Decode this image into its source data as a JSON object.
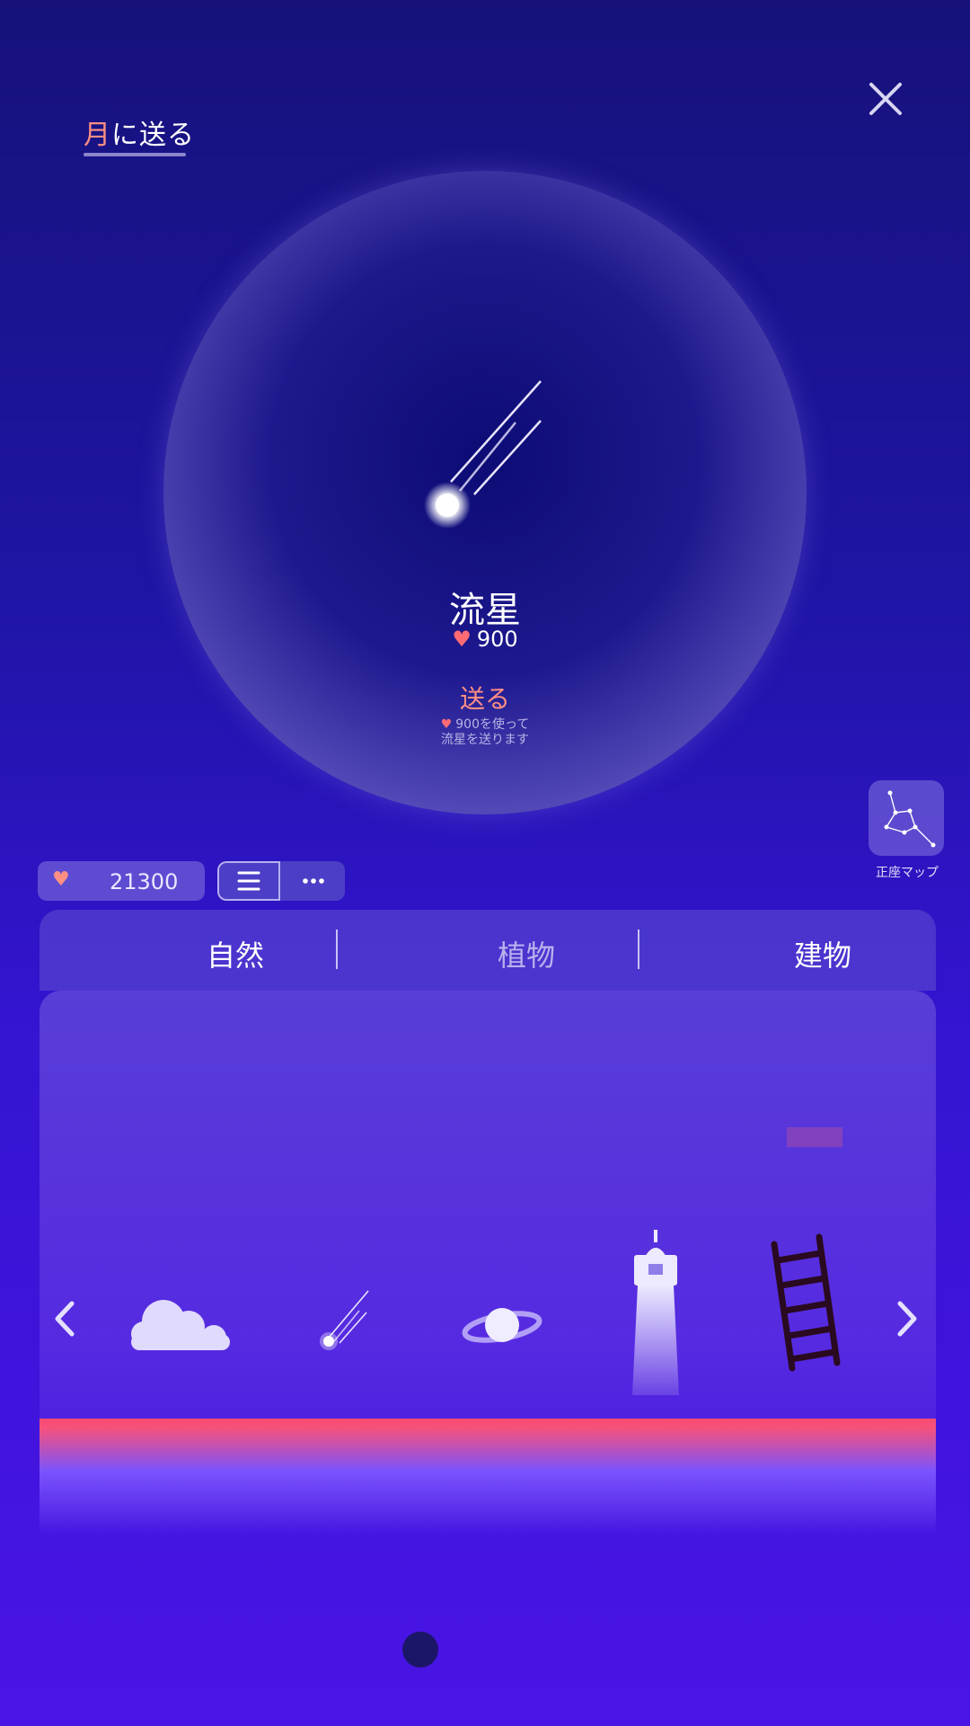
{
  "header": {
    "title_highlight": "月",
    "title_rest": "に送る",
    "close_icon": "close-icon"
  },
  "selected_item": {
    "name": "流星",
    "price": "900",
    "send_label": "送る",
    "send_note_line1": "900を使って",
    "send_note_line2": "流星を送ります",
    "icon": "meteor-icon"
  },
  "constellation": {
    "label": "正座マップ",
    "icon": "constellation-icon"
  },
  "wallet": {
    "hearts": "21300",
    "icon": "heart-icon"
  },
  "view_toggle": {
    "list_icon": "list-icon",
    "more_icon": "more-icon"
  },
  "tabs": [
    {
      "label": "自然"
    },
    {
      "label": "植物"
    },
    {
      "label": "建物"
    }
  ],
  "items": [
    {
      "icon": "cloud-icon"
    },
    {
      "icon": "meteor-icon"
    },
    {
      "icon": "planet-icon"
    },
    {
      "icon": "lighthouse-icon"
    },
    {
      "icon": "ladder-icon"
    }
  ],
  "colors": {
    "accent": "#ff8f83",
    "heart": "#ff6b73",
    "background_top": "#16127a",
    "background_bottom": "#4a14e6"
  }
}
